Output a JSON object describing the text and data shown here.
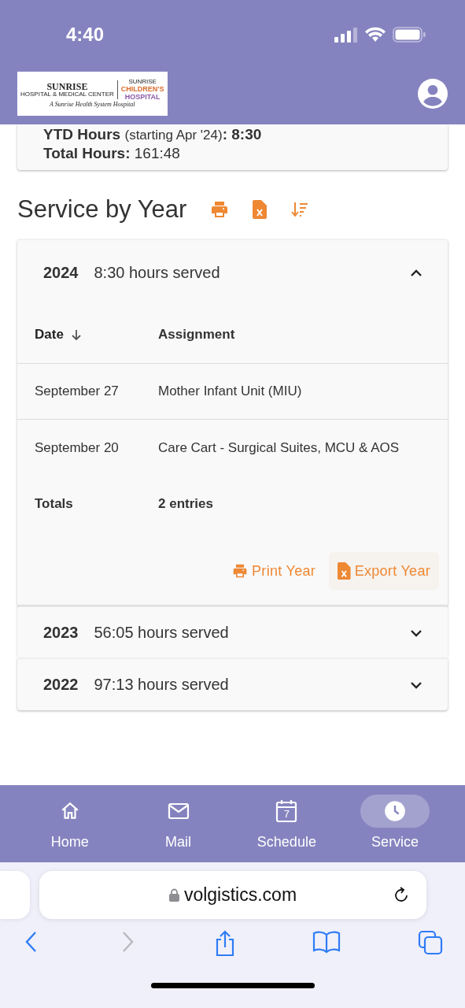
{
  "status_bar": {
    "time": "4:40"
  },
  "header": {
    "logo": {
      "left_name": "SUNRISE",
      "left_sub": "HOSPITAL & MEDICAL CENTER",
      "right_top": "SUNRISE",
      "right_name": "CHILDREN'S",
      "right_name2": "HOSPITAL",
      "tagline": "A Sunrise Health System Hospital"
    }
  },
  "summary": [
    {
      "label": "YTD Hours",
      "note": "(starting Apr '24)",
      "value": ": 8:30"
    },
    {
      "label": "Total Hours:",
      "value": "161:48"
    }
  ],
  "section_title": "Service by Year",
  "years": [
    {
      "year": "2024",
      "hours": "8:30 hours served",
      "expanded": true,
      "columns": [
        {
          "label": "Date",
          "sorted": true
        },
        {
          "label": "Assignment",
          "sorted": false
        }
      ],
      "rows": [
        {
          "date": "September 27",
          "assignment": "Mother Infant Unit (MIU)"
        },
        {
          "date": "September 20",
          "assignment": "Care Cart - Surgical Suites, MCU & AOS"
        }
      ],
      "totals": {
        "label": "Totals",
        "value": "2 entries"
      },
      "actions": [
        {
          "kind": "print",
          "label": "Print Year",
          "selected": false
        },
        {
          "kind": "export",
          "label": "Export Year",
          "selected": true
        }
      ]
    },
    {
      "year": "2023",
      "hours": "56:05 hours served",
      "expanded": false
    },
    {
      "year": "2022",
      "hours": "97:13 hours served",
      "expanded": false
    }
  ],
  "bottom_nav": [
    {
      "kind": "home",
      "label": "Home",
      "selected": false
    },
    {
      "kind": "mail",
      "label": "Mail",
      "selected": false
    },
    {
      "kind": "schedule",
      "label": "Schedule",
      "icon_text": "7",
      "selected": false
    },
    {
      "kind": "service",
      "label": "Service",
      "selected": true
    }
  ],
  "browser": {
    "url": "volgistics.com"
  }
}
